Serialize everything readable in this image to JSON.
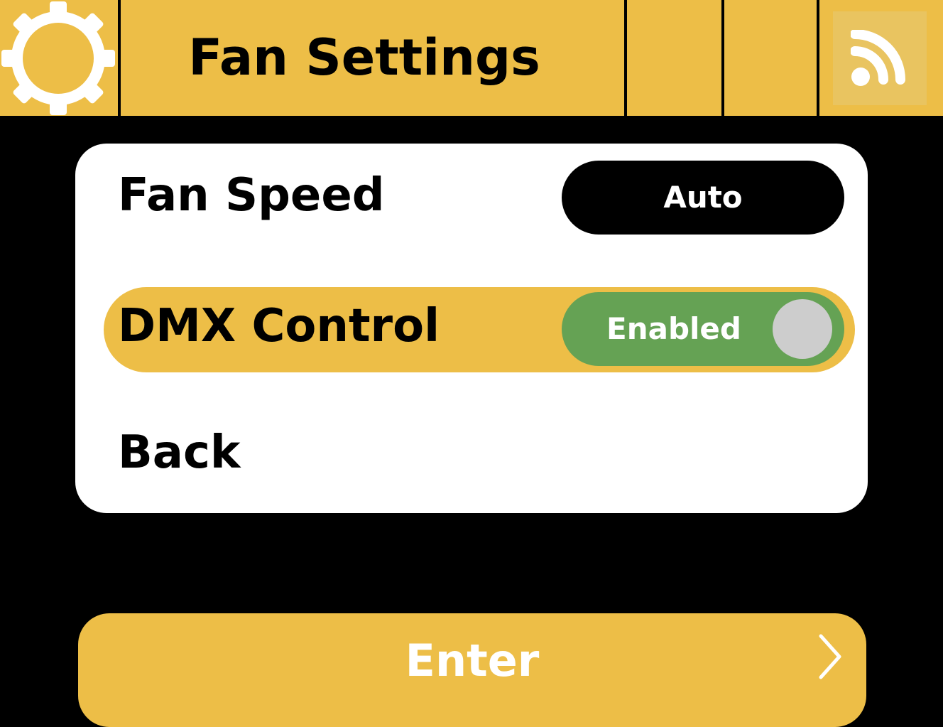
{
  "header": {
    "title": "Fan Settings",
    "left_icon": "gear-icon",
    "right_icon": "signal-icon"
  },
  "menu": {
    "fan_speed": {
      "label": "Fan Speed",
      "value": "Auto"
    },
    "dmx_control": {
      "label": "DMX Control",
      "value": "Enabled",
      "toggle_on": true,
      "selected": true
    },
    "back": {
      "label": "Back"
    }
  },
  "footer": {
    "enter_label": "Enter",
    "chevron_icon": "chevron-right-icon"
  },
  "colors": {
    "accent": "#EDBE47",
    "background": "#000000",
    "panel": "#FFFFFF",
    "toggle_on": "#65A254",
    "knob": "#CDCDCD",
    "icon_button": "#E9C460"
  }
}
